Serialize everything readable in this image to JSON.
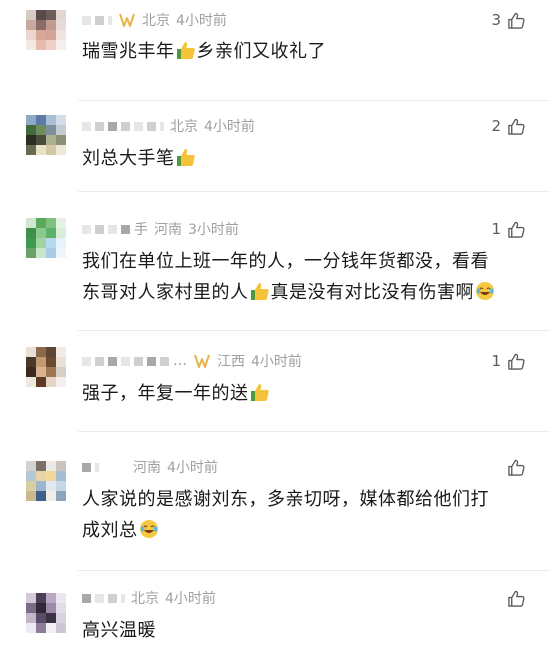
{
  "comments": [
    {
      "region": "北京",
      "time": "4小时前",
      "likes": "3",
      "text_parts": [
        "瑞雪兆丰年",
        "乡亲们又收礼了"
      ]
    },
    {
      "region": "北京",
      "time": "4小时前",
      "likes": "2",
      "text_parts": [
        "刘总大手笔"
      ]
    },
    {
      "name_visible": "手",
      "region": "河南",
      "time": "3小时前",
      "likes": "1",
      "text_parts": [
        "我们在单位上班一年的人，一分钱年货都没，看看",
        "东哥对人家村里的人",
        "真是没有对比没有伤害啊"
      ]
    },
    {
      "name_visible": "…",
      "region": "江西",
      "time": "4小时前",
      "likes": "1",
      "text_parts": [
        "强子，年复一年的送"
      ]
    },
    {
      "region": "河南",
      "time": "4小时前",
      "likes": "",
      "text_parts": [
        "人家说的是感谢刘东，多亲切呀，媒体都给他们打",
        "成刘总"
      ]
    },
    {
      "region": "北京",
      "time": "4小时前",
      "likes": "",
      "text_parts": [
        "高兴温暖"
      ]
    }
  ],
  "icons": {
    "like": "thumbs-up-outline-icon",
    "thumbs_emoji": "thumbs-up-emoji-icon",
    "laugh_emoji": "laughing-tears-emoji-icon",
    "vip": "vip-badge-icon"
  },
  "colors": {
    "meta_text": "#9a9a9a",
    "body_text": "#1a1a1a",
    "vip_gold": "#e8b44a",
    "divider": "#ececec"
  }
}
